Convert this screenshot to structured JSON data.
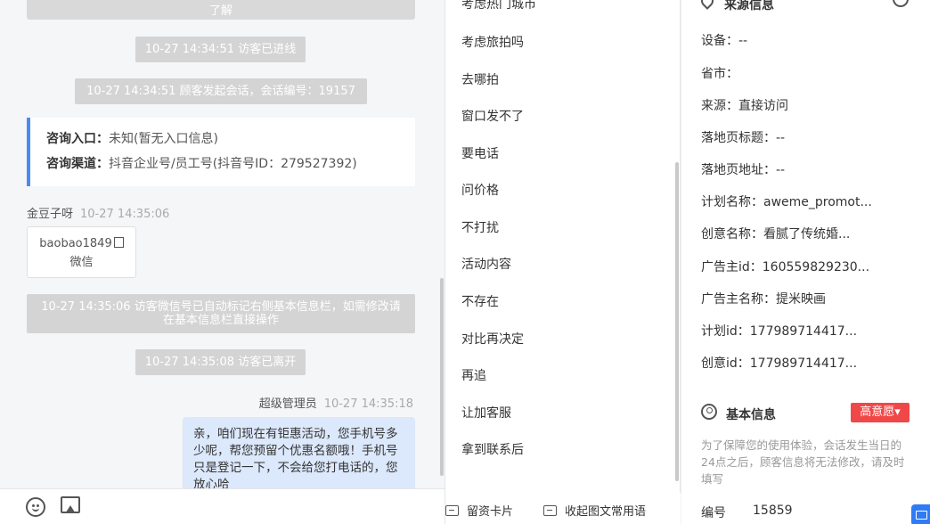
{
  "chat": {
    "top_card_text": "了解",
    "sys_entered": "10-27 14:34:51 访客已进线",
    "sys_session": "10-27 14:34:51 顾客发起会话，会话编号：19157",
    "entry_label": "咨询入口：",
    "entry_value": "未知(暂无入口信息)",
    "channel_label": "咨询渠道：",
    "channel_value": "抖音企业号/员工号(抖音号ID：279527392)",
    "visitor_name": "金豆子呀",
    "visitor_time": "10-27 14:35:06",
    "wechat_id": "baobao1849",
    "wechat_label": "微信",
    "sys_wechat": "10-27 14:35:06 访客微信号已自动标记右侧基本信息栏，如需修改请在基本信息栏直接操作",
    "sys_left": "10-27 14:35:08 访客已离开",
    "agent_name": "超级管理员",
    "agent_time": "10-27 14:35:18",
    "agent_message": "亲，咱们现在有钜惠活动，您手机号多少呢，帮您预留个优惠名额哦！手机号只是登记一下，不会给您打电话的，您放心哈"
  },
  "toolbar": {
    "emoji_icon": "emoji-icon",
    "image_icon": "image-icon"
  },
  "phrases": {
    "items": [
      "考虑热门城市",
      "考虑旅拍吗",
      "去哪拍",
      "窗口发不了",
      "要电话",
      "问价格",
      "不打扰",
      "活动内容",
      "不存在",
      "对比再决定",
      "再追",
      "让加客服",
      "拿到联系后"
    ],
    "bottom_card": "留资卡片",
    "bottom_collapse": "收起图文常用语"
  },
  "side": {
    "source_title": "来源信息",
    "fields": [
      "设备：--",
      "省市：",
      "来源：直接访问",
      "落地页标题：--",
      "落地页地址：--",
      "计划名称：aweme_promot...",
      "创意名称：看腻了传统婚...",
      "广告主id：160559829230...",
      "广告主名称：提米映画",
      "计划id：177989714417...",
      "创意id：177989714417..."
    ],
    "basic_title": "基本信息",
    "intent_badge": "高意愿▾",
    "notice": "为了保障您的使用体验，会话发生当日的24点之后，顾客信息将无法修改，请及时填写",
    "number_label": "编号",
    "number_value": "15859"
  }
}
